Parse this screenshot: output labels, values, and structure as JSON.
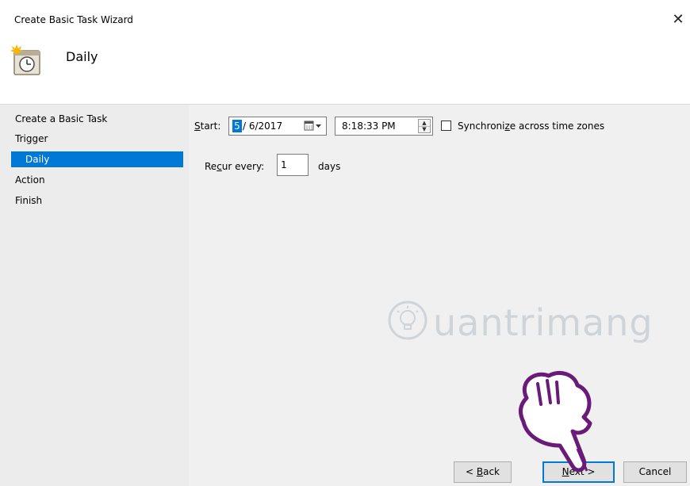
{
  "window": {
    "title": "Create Basic Task Wizard",
    "close_glyph": "✕"
  },
  "header": {
    "title": "Daily",
    "icon": "task-scheduler-clock-icon"
  },
  "steps": [
    {
      "label": "Create a Basic Task",
      "selected": false
    },
    {
      "label": "Trigger",
      "selected": false
    },
    {
      "label": "Daily",
      "selected": true
    },
    {
      "label": "Action",
      "selected": false
    },
    {
      "label": "Finish",
      "selected": false
    }
  ],
  "trigger": {
    "start_prefix": "",
    "start_key": "S",
    "start_suffix": "tart:",
    "date_month": "5",
    "date_rest": "/ 6/2017",
    "time_value": "8:18:33 PM",
    "sync_before": "Synchroni",
    "sync_key": "z",
    "sync_after": "e across time zones",
    "sync_checked": false,
    "recur_before": "Re",
    "recur_key": "c",
    "recur_after": "ur every:",
    "recur_value": "1",
    "recur_unit": "days"
  },
  "buttons": {
    "back_prefix": "< ",
    "back_key": "B",
    "back_rest": "ack",
    "next_key": "N",
    "next_rest": "ext >",
    "cancel_label": "Cancel"
  },
  "watermark": {
    "text": "uantrimang",
    "icon": "lightbulb-icon"
  },
  "colors": {
    "accent": "#0078d7",
    "steps_bg": "#ececec",
    "content_bg": "#f0f0f0"
  }
}
